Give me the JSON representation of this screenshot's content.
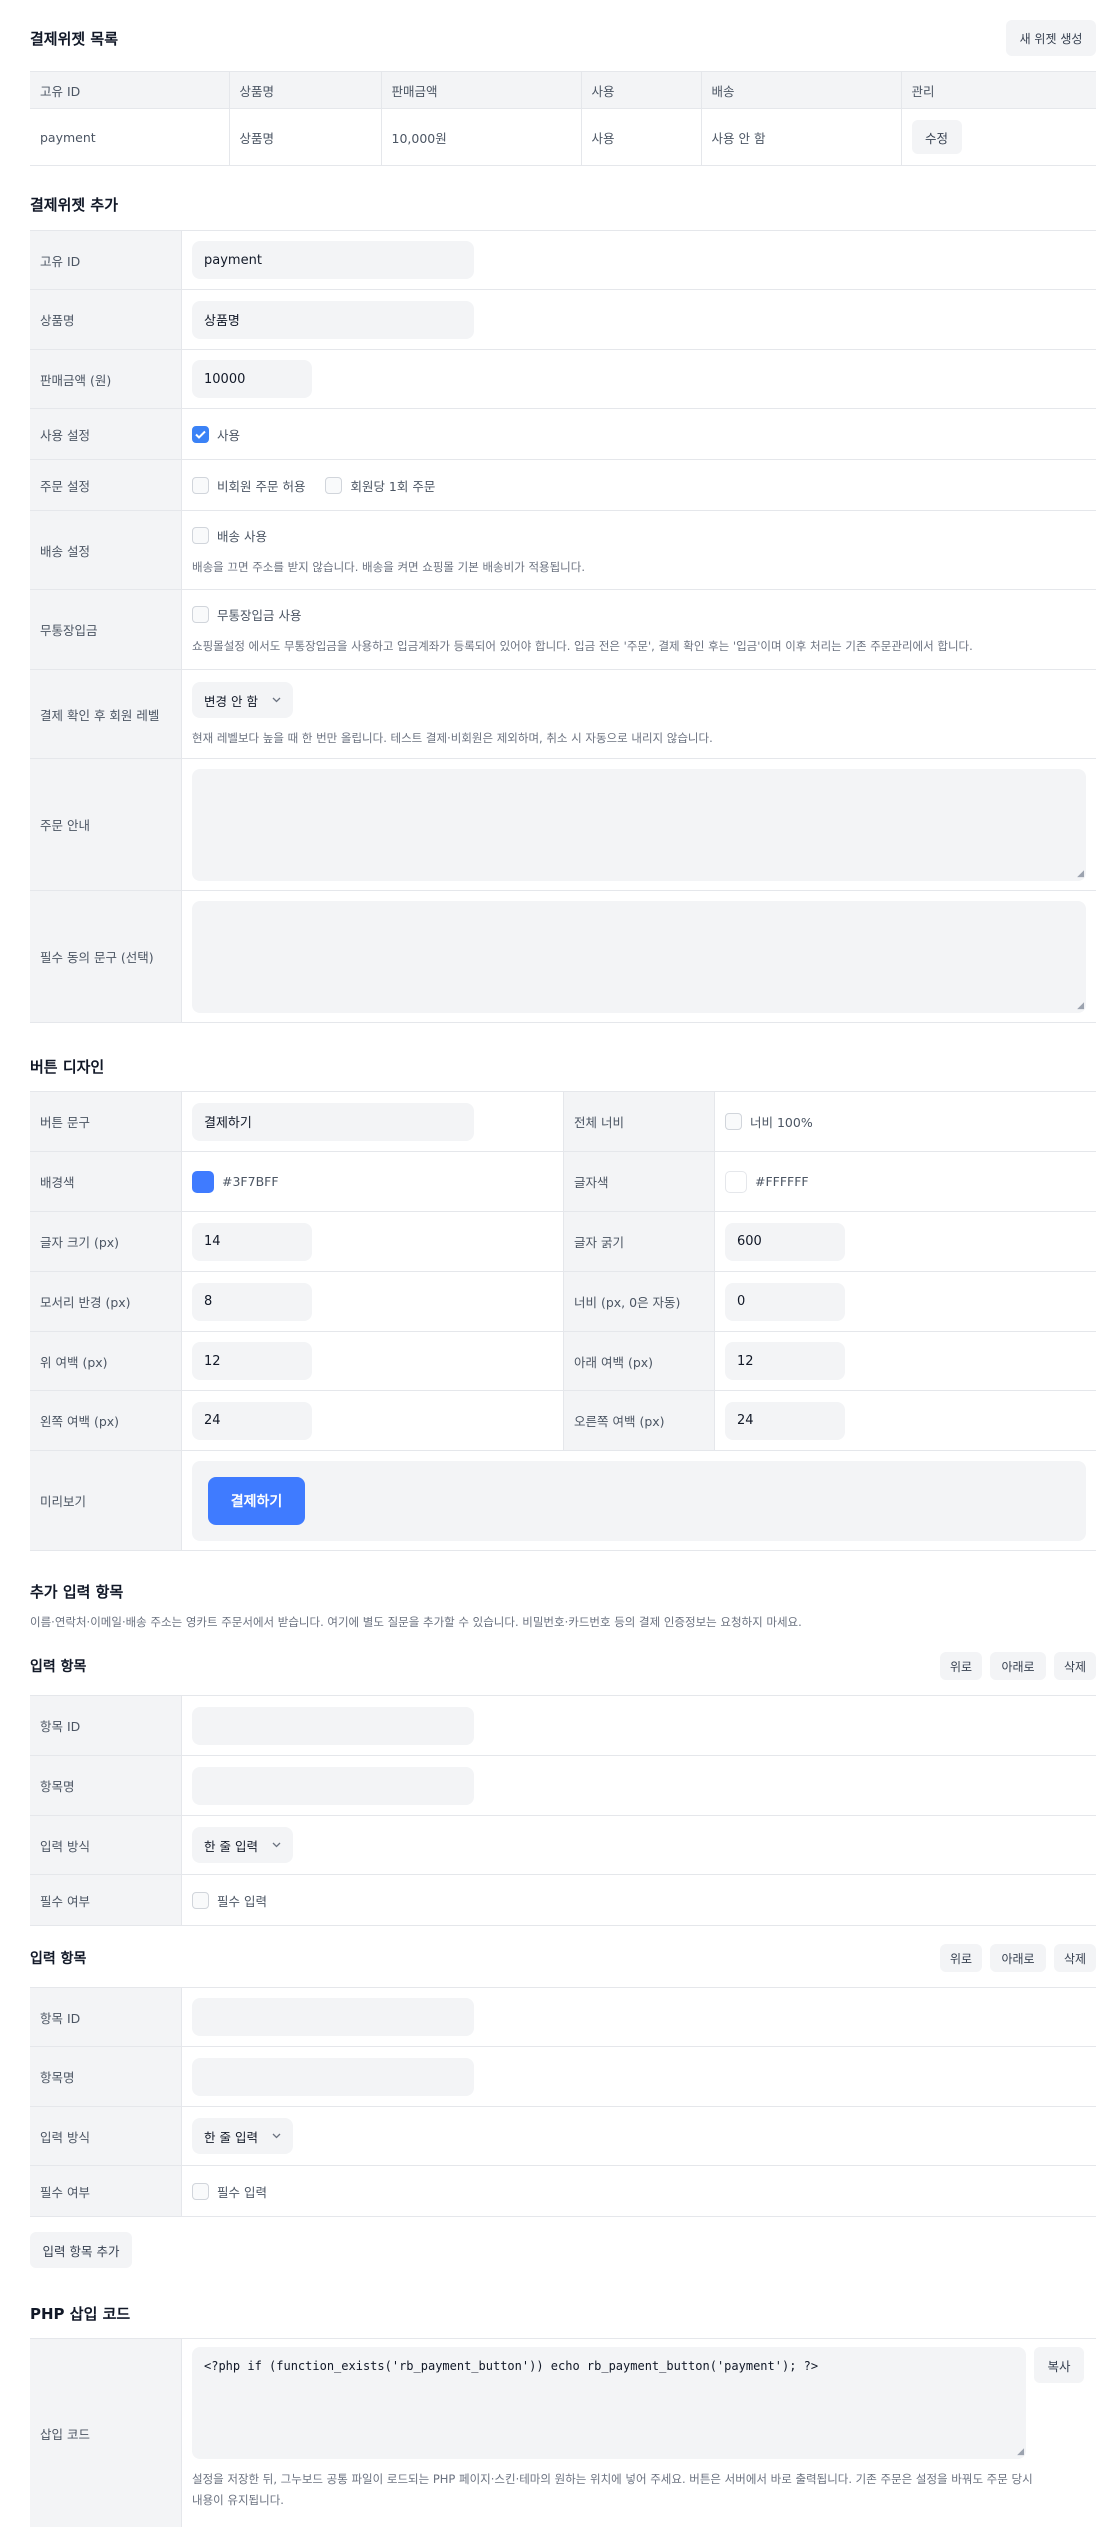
{
  "colors": {
    "accent": "#3B82F6",
    "label_bg": "#F3F4F6",
    "border": "#E5E7EB"
  },
  "widget_list": {
    "title": "결제위젯 목록",
    "new_button": "새 위젯 생성",
    "columns": [
      "고유 ID",
      "상품명",
      "판매금액",
      "사용",
      "배송",
      "관리"
    ],
    "rows": [
      {
        "id": "payment",
        "name": "상품명",
        "price": "10,000원",
        "use": "사용",
        "ship": "사용 안 함",
        "edit": "수정"
      }
    ]
  },
  "add_widget": {
    "title": "결제위젯 추가",
    "id": {
      "label": "고유 ID",
      "value": "payment"
    },
    "name": {
      "label": "상품명",
      "value": "상품명"
    },
    "price": {
      "label": "판매금액 (원)",
      "value": "10000"
    },
    "use": {
      "label": "사용 설정",
      "option": "사용",
      "checked": true
    },
    "order": {
      "label": "주문 설정",
      "option1": "비회원 주문 허용",
      "option2": "회원당 1회 주문"
    },
    "ship": {
      "label": "배송 설정",
      "option": "배송 사용",
      "hint": "배송을 끄면 주소를 받지 않습니다. 배송을 켜면 쇼핑몰 기본 배송비가 적용됩니다."
    },
    "bank": {
      "label": "무통장입금",
      "option": "무통장입금 사용",
      "hint": "쇼핑몰설정 에서도 무통장입금을 사용하고 입금계좌가 등록되어 있어야 합니다. 입금 전은 '주문', 결제 확인 후는 '입금'이며 이후 처리는 기존 주문관리에서 합니다."
    },
    "level": {
      "label": "결제 확인 후 회원 레벨",
      "value": "변경 안 함",
      "hint": "현재 레벨보다 높을 때 한 번만 올립니다. 테스트 결제·비회원은 제외하며, 취소 시 자동으로 내리지 않습니다."
    },
    "guide": {
      "label": "주문 안내"
    },
    "agree": {
      "label": "필수 동의 문구 (선택)"
    }
  },
  "button_design": {
    "title": "버튼 디자인",
    "text": {
      "label": "버튼 문구",
      "value": "결제하기"
    },
    "full": {
      "label": "전체 너비",
      "option": "너비 100%"
    },
    "bg": {
      "label": "배경색",
      "value": "#3F7BFF"
    },
    "fg": {
      "label": "글자색",
      "value": "#FFFFFF"
    },
    "font_size": {
      "label": "글자 크기 (px)",
      "value": "14"
    },
    "font_weight": {
      "label": "글자 굵기",
      "value": "600"
    },
    "radius": {
      "label": "모서리 반경 (px)",
      "value": "8"
    },
    "width": {
      "label": "너비 (px, 0은 자동)",
      "value": "0"
    },
    "pad_top": {
      "label": "위 여백 (px)",
      "value": "12"
    },
    "pad_bottom": {
      "label": "아래 여백 (px)",
      "value": "12"
    },
    "pad_left": {
      "label": "왼쪽 여백 (px)",
      "value": "24"
    },
    "pad_right": {
      "label": "오른쪽 여백 (px)",
      "value": "24"
    },
    "preview": {
      "label": "미리보기",
      "button": "결제하기"
    }
  },
  "extra_fields": {
    "title": "추가 입력 항목",
    "desc": "이름·연락처·이메일·배송 주소는 영카트 주문서에서 받습니다. 여기에 별도 질문을 추가할 수 있습니다. 비밀번호·카드번호 등의 결제 인증정보는 요청하지 마세요.",
    "items": [
      {
        "title": "입력 항목",
        "up": "위로",
        "down": "아래로",
        "del": "삭제",
        "id_label": "항목 ID",
        "name_label": "항목명",
        "type_label": "입력 방식",
        "type_value": "한 줄 입력",
        "req_label": "필수 여부",
        "req_option": "필수 입력"
      },
      {
        "title": "입력 항목",
        "up": "위로",
        "down": "아래로",
        "del": "삭제",
        "id_label": "항목 ID",
        "name_label": "항목명",
        "type_label": "입력 방식",
        "type_value": "한 줄 입력",
        "req_label": "필수 여부",
        "req_option": "필수 입력"
      }
    ],
    "add_button": "입력 항목 추가"
  },
  "php_code": {
    "title": "PHP 삽입 코드",
    "label": "삽입 코드",
    "code": "<?php if (function_exists('rb_payment_button')) echo rb_payment_button('payment'); ?>",
    "copy": "복사",
    "hint": "설정을 저장한 뒤, 그누보드 공통 파일이 로드되는 PHP 페이지·스킨·테마의 원하는 위치에 넣어 주세요. 버튼은 서버에서 바로 출력됩니다. 기존 주문은 설정을 바꿔도 주문 당시 내용이 유지됩니다."
  }
}
